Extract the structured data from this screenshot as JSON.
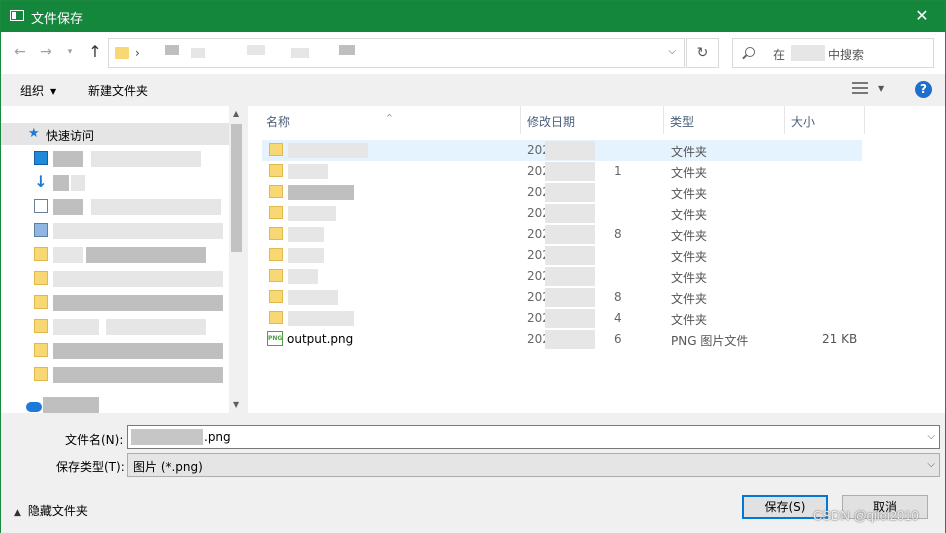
{
  "titlebar": {
    "title": "文件保存",
    "close_glyph": "✕"
  },
  "nav": {
    "back": "←",
    "forward": "→",
    "recent": "▾",
    "up": "↑",
    "address_sep": "›",
    "address_dropdown": "⌵",
    "refresh": "↻"
  },
  "search": {
    "placeholder_prefix": "在",
    "placeholder_suffix": "中搜索"
  },
  "toolbar": {
    "organize_label": "组织",
    "caret": "▼",
    "new_folder_label": "新建文件夹",
    "help_label": "?"
  },
  "nav_pane": {
    "quick_access_label": "快速访问",
    "scroll_up": "▲",
    "scroll_down": "▼"
  },
  "columns": {
    "name": "名称",
    "modified": "修改日期",
    "type": "类型",
    "size": "大小",
    "sort_caret": "^"
  },
  "files": [
    {
      "date_prefix": "202",
      "date_tail": "",
      "type": "文件夹",
      "size": ""
    },
    {
      "date_prefix": "202",
      "date_tail": "1",
      "type": "文件夹",
      "size": ""
    },
    {
      "date_prefix": "202",
      "date_tail": "",
      "type": "文件夹",
      "size": ""
    },
    {
      "date_prefix": "202",
      "date_tail": "",
      "type": "文件夹",
      "size": ""
    },
    {
      "date_prefix": "202",
      "date_tail": "8",
      "type": "文件夹",
      "size": ""
    },
    {
      "date_prefix": "202",
      "date_tail": "",
      "type": "文件夹",
      "size": ""
    },
    {
      "date_prefix": "202",
      "date_tail": "",
      "type": "文件夹",
      "size": ""
    },
    {
      "date_prefix": "202",
      "date_tail": "8",
      "type": "文件夹",
      "size": ""
    },
    {
      "date_prefix": "202",
      "date_tail": "4",
      "type": "文件夹",
      "size": ""
    },
    {
      "name": "output.png",
      "icon_text": "PNG",
      "date_prefix": "202",
      "date_tail": "6",
      "type": "PNG 图片文件",
      "size": "21 KB"
    }
  ],
  "form": {
    "filename_label": "文件名(N):",
    "filename_value": ".png",
    "filetype_label": "保存类型(T):",
    "filetype_value": "图片 (*.png)",
    "dropdown_glyph": "⌵"
  },
  "footer": {
    "hide_folders_label": "隐藏文件夹",
    "hide_caret": "▲",
    "save_label": "保存(S)",
    "cancel_label": "取消",
    "watermark": "CSDN @qilei2010"
  },
  "colors": {
    "titlebar": "#14873d",
    "selection": "#e5f3ff",
    "accent": "#0078d7"
  }
}
